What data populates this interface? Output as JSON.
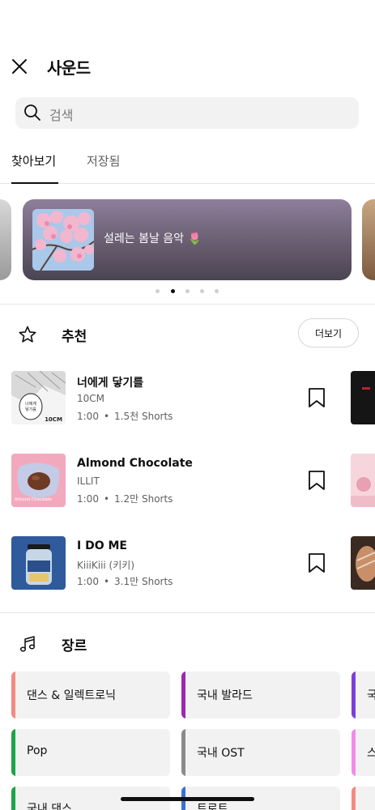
{
  "header": {
    "title": "사운드",
    "close_icon": "close-icon"
  },
  "search": {
    "placeholder": "검색",
    "icon": "search-icon"
  },
  "tabs": [
    {
      "label": "찾아보기",
      "active": true
    },
    {
      "label": "저장됨",
      "active": false
    }
  ],
  "carousel": {
    "active_index": 1,
    "dot_count": 5,
    "card": {
      "title": "설레는 봄날 음악 🌷"
    }
  },
  "recommended": {
    "icon": "star-icon",
    "title": "추천",
    "more_label": "더보기",
    "tracks": [
      {
        "title": "너에게 닿기를",
        "artist": "10CM",
        "duration": "1:00",
        "shorts": "1.5천 Shorts",
        "thumb_text": "10CM"
      },
      {
        "title": "Almond Chocolate",
        "artist": "ILLIT",
        "duration": "1:00",
        "shorts": "1.2만 Shorts",
        "thumb_text": "Almond Chocolate"
      },
      {
        "title": "I DO ME",
        "artist": "KiiiKiii (키키)",
        "duration": "1:00",
        "shorts": "3.1만 Shorts",
        "thumb_text": ""
      }
    ]
  },
  "genres": {
    "icon": "music-note-icon",
    "title": "장르",
    "items": [
      {
        "label": "댄스 & 일렉트로닉",
        "color": "#f28b82"
      },
      {
        "label": "국내 발라드",
        "color": "#9c27b0"
      },
      {
        "label": "국",
        "color": "#7e3fd6"
      },
      {
        "label": "Pop",
        "color": "#1ea446"
      },
      {
        "label": "국내 OST",
        "color": "#8a8a8a"
      },
      {
        "label": "스",
        "color": "#f28bea"
      },
      {
        "label": "국내 댄스",
        "color": "#1ea446"
      },
      {
        "label": "트로트",
        "color": "#3b6fd8"
      },
      {
        "label": "",
        "color": "#f28b82"
      }
    ]
  }
}
